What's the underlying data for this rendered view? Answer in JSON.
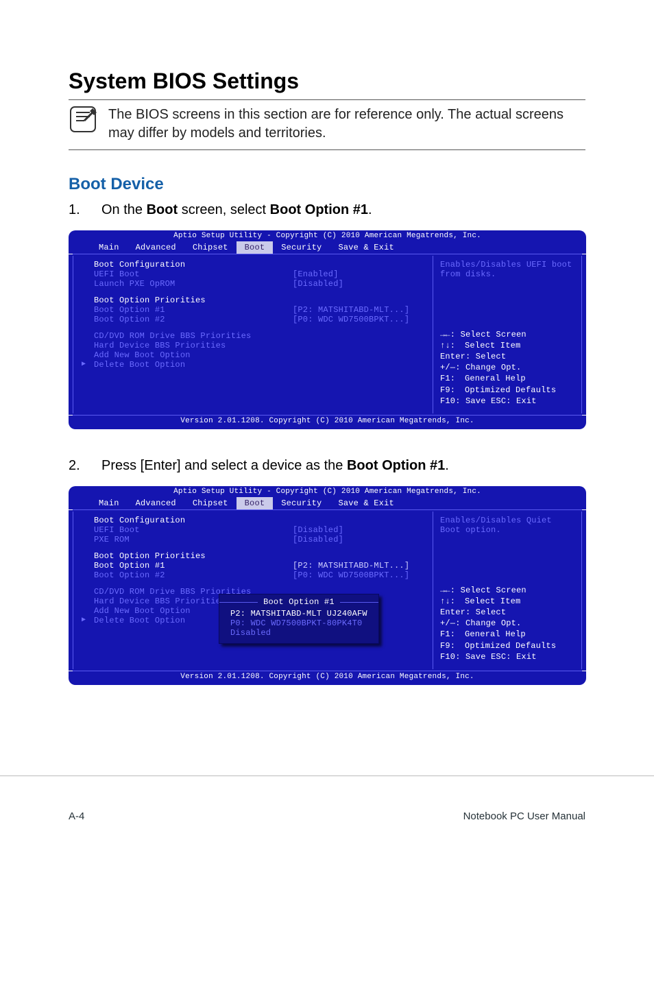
{
  "title": "System BIOS Settings",
  "note": "The BIOS screens in this section are for reference only. The actual screens may differ by models and territories.",
  "section": "Boot Device",
  "step1_num": "1.",
  "step1_pre": "On the ",
  "step1_bold1": "Boot",
  "step1_mid": " screen, select ",
  "step1_bold2": "Boot Option #1",
  "step1_post": ".",
  "step2_num": "2.",
  "step2_pre": "Press [Enter] and select a device as the ",
  "step2_bold1": "Boot Option #1",
  "step2_post": ".",
  "footer_left": "A-4",
  "footer_right": "Notebook PC User Manual",
  "bios": {
    "top": "Aptio Setup Utility - Copyright (C) 2010 American Megatrends, Inc.",
    "tabs": {
      "main": "Main",
      "advanced": "Advanced",
      "chipset": "Chipset",
      "boot": "Boot",
      "security": "Security",
      "save_exit": "Save & Exit"
    },
    "version": "Version 2.01.1208. Copyright (C) 2010 American Megatrends, Inc."
  },
  "s1": {
    "heading1": "Boot Configuration",
    "uefi_label": "UEFI Boot",
    "uefi_value": "[Enabled]",
    "pxe_label": "Launch PXE OpROM",
    "pxe_value": "[Disabled]",
    "heading2": "Boot Option Priorities",
    "bo1_label": "Boot Option #1",
    "bo1_value": "[P2: MATSHITABD-MLT...]",
    "bo2_label": "Boot Option #2",
    "bo2_value": "[P0: WDC WD7500BPKT...]",
    "sub1": "CD/DVD ROM Drive BBS Priorities",
    "sub2": "Hard Device BBS Priorities",
    "sub3": "Add New Boot Option",
    "sub4": "Delete Boot Option",
    "help": "Enables/Disables UEFI boot from disks."
  },
  "s2": {
    "heading1": "Boot Configuration",
    "uefi_label": "UEFI Boot",
    "uefi_value": "[Disabled]",
    "pxe_label": "PXE ROM",
    "pxe_value": "[Disabled]",
    "heading2": "Boot Option Priorities",
    "bo1_label": "Boot Option #1",
    "bo1_value": "[P2: MATSHITABD-MLT...]",
    "bo2_label": "Boot Option #2",
    "bo2_value": "[P0: WDC WD7500BPKT...]",
    "sub1": "CD/DVD ROM Drive BBS Priorities",
    "sub2": "Hard Device BBS Priorities",
    "sub3": "Add New Boot Option",
    "sub4": "Delete Boot Option",
    "help": "Enables/Disables Quiet Boot option.",
    "popup_title": "Boot Option #1",
    "popup_opts": {
      "p2": "P2: MATSHITABD-MLT UJ240AFW",
      "p0": "P0: WDC WD7500BPKT-80PK4T0",
      "dis": "Disabled"
    }
  },
  "keys": {
    "k1": "→←: Select Screen",
    "k2_sym": "↑↓:",
    "k2_txt": "Select Item",
    "k3": "Enter: Select",
    "k4": "+/—:  Change Opt.",
    "k5_sym": "F1:",
    "k5_txt": "General Help",
    "k6_sym": "F9:",
    "k6_txt": "Optimized Defaults",
    "k7": "F10: Save   ESC: Exit"
  }
}
